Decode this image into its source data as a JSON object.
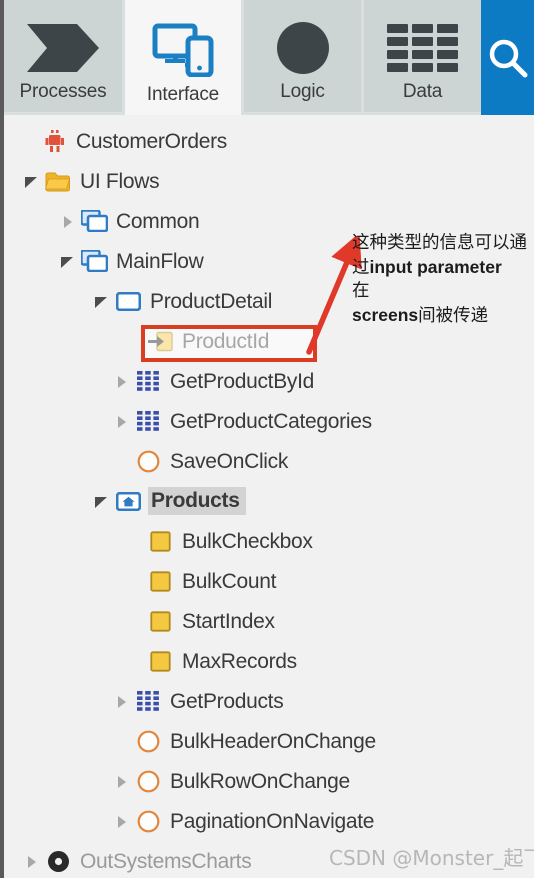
{
  "toolbar": {
    "tabs": [
      {
        "label": "Processes",
        "icon": "process-flag-icon",
        "active": false
      },
      {
        "label": "Interface",
        "icon": "devices-icon",
        "active": true
      },
      {
        "label": "Logic",
        "icon": "circle-icon",
        "active": false
      },
      {
        "label": "Data",
        "icon": "data-grid-icon",
        "active": false
      }
    ],
    "search": {
      "icon": "search-icon",
      "label": "Search",
      "color": "#0d7bc4"
    }
  },
  "tree": {
    "nodes": [
      {
        "label": "CustomerOrders",
        "icon": "application-icon",
        "depth": 0,
        "twisty": "none",
        "selected": false,
        "muted": false
      },
      {
        "label": "UI Flows",
        "icon": "folder-icon",
        "depth": 1,
        "twisty": "expanded",
        "selected": false,
        "muted": false
      },
      {
        "label": "Common",
        "icon": "flow-icon",
        "depth": 2,
        "twisty": "collapsed",
        "selected": false,
        "muted": false
      },
      {
        "label": "MainFlow",
        "icon": "flow-icon",
        "depth": 2,
        "twisty": "expanded",
        "selected": false,
        "muted": false
      },
      {
        "label": "ProductDetail",
        "icon": "screen-icon",
        "depth": 3,
        "twisty": "expanded",
        "selected": false,
        "muted": false
      },
      {
        "label": "ProductId",
        "icon": "input-parameter-icon",
        "depth": 4,
        "twisty": "none",
        "selected": false,
        "muted": false
      },
      {
        "label": "GetProductById",
        "icon": "aggregate-icon",
        "depth": 4,
        "twisty": "collapsed",
        "selected": false,
        "muted": false
      },
      {
        "label": "GetProductCategories",
        "icon": "aggregate-icon",
        "depth": 4,
        "twisty": "collapsed",
        "selected": false,
        "muted": false
      },
      {
        "label": "SaveOnClick",
        "icon": "client-action-icon",
        "depth": 4,
        "twisty": "none",
        "selected": false,
        "muted": false
      },
      {
        "label": "Products",
        "icon": "home-screen-icon",
        "depth": 3,
        "twisty": "expanded",
        "selected": true,
        "muted": false
      },
      {
        "label": "BulkCheckbox",
        "icon": "local-variable-icon",
        "depth": 4,
        "twisty": "none",
        "selected": false,
        "muted": false
      },
      {
        "label": "BulkCount",
        "icon": "local-variable-icon",
        "depth": 4,
        "twisty": "none",
        "selected": false,
        "muted": false
      },
      {
        "label": "StartIndex",
        "icon": "local-variable-icon",
        "depth": 4,
        "twisty": "none",
        "selected": false,
        "muted": false
      },
      {
        "label": "MaxRecords",
        "icon": "local-variable-icon",
        "depth": 4,
        "twisty": "none",
        "selected": false,
        "muted": false
      },
      {
        "label": "GetProducts",
        "icon": "aggregate-icon",
        "depth": 4,
        "twisty": "collapsed",
        "selected": false,
        "muted": false
      },
      {
        "label": "BulkHeaderOnChange",
        "icon": "client-action-icon",
        "depth": 4,
        "twisty": "none",
        "selected": false,
        "muted": false
      },
      {
        "label": "BulkRowOnChange",
        "icon": "client-action-icon",
        "depth": 4,
        "twisty": "collapsed",
        "selected": false,
        "muted": false
      },
      {
        "label": "PaginationOnNavigate",
        "icon": "client-action-icon",
        "depth": 4,
        "twisty": "collapsed",
        "selected": false,
        "muted": false
      },
      {
        "label": "OutSystemsCharts",
        "icon": "module-icon",
        "depth": 1,
        "twisty": "collapsed",
        "selected": false,
        "muted": true
      }
    ]
  },
  "annotation": {
    "line1": "这种类型的信息可以通",
    "line2_cn": "过",
    "line2_en": "input parameter",
    "line3": "在",
    "line4_en": "screens",
    "line4_cn": "间被传递",
    "highlight_target": "ProductId",
    "color": "#d93e22"
  },
  "watermark": {
    "text": "CSDN @Monster_起飞"
  }
}
